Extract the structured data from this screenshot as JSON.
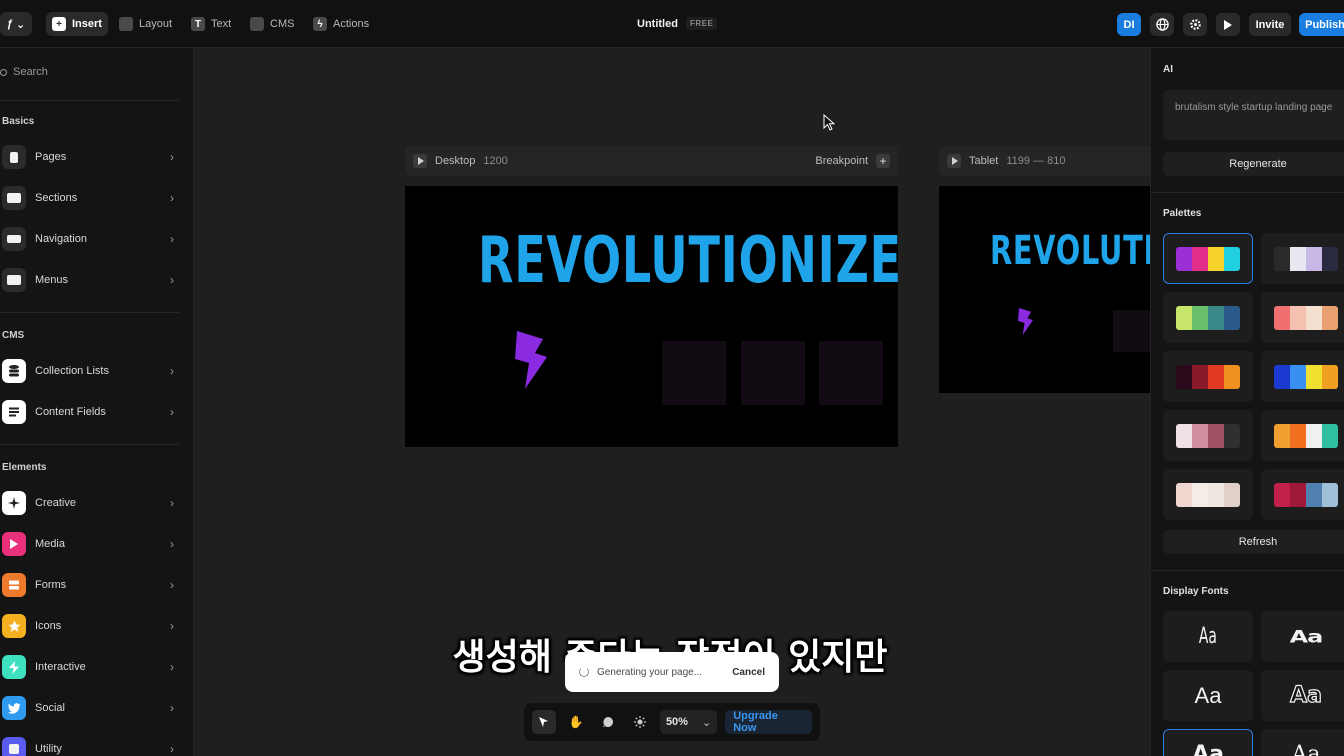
{
  "toolbar": {
    "items": [
      {
        "label": "Insert",
        "icon": "plus-icon"
      },
      {
        "label": "Layout",
        "icon": "layout-icon"
      },
      {
        "label": "Text",
        "icon": "text-icon"
      },
      {
        "label": "CMS",
        "icon": "database-icon"
      },
      {
        "label": "Actions",
        "icon": "bolt-icon"
      }
    ],
    "title": "Untitled",
    "plan_badge": "FREE",
    "avatar_initials": "DI",
    "invite_label": "Invite",
    "publish_label": "Publish"
  },
  "left_panel": {
    "search_placeholder": "Search",
    "sections": {
      "basics": {
        "title": "Basics",
        "items": [
          {
            "label": "Pages",
            "color": "#2b2b2b"
          },
          {
            "label": "Sections",
            "color": "#2b2b2b"
          },
          {
            "label": "Navigation",
            "color": "#2b2b2b"
          },
          {
            "label": "Menus",
            "color": "#2b2b2b"
          }
        ]
      },
      "cms": {
        "title": "CMS",
        "items": [
          {
            "label": "Collection Lists",
            "color": "#ffffff"
          },
          {
            "label": "Content Fields",
            "color": "#ffffff"
          }
        ]
      },
      "elements": {
        "title": "Elements",
        "items": [
          {
            "label": "Creative",
            "color": "#ffffff"
          },
          {
            "label": "Media",
            "color": "#e8317a"
          },
          {
            "label": "Forms",
            "color": "#f07a2c"
          },
          {
            "label": "Icons",
            "color": "#f5b020"
          },
          {
            "label": "Interactive",
            "color": "#3ee0c0"
          },
          {
            "label": "Social",
            "color": "#2f9bf0"
          },
          {
            "label": "Utility",
            "color": "#5b5bf0"
          }
        ]
      }
    }
  },
  "canvas": {
    "desktop": {
      "label": "Desktop",
      "width": "1200",
      "breakpoint_label": "Breakpoint"
    },
    "tablet": {
      "label": "Tablet",
      "range": "1199 — 810"
    },
    "hero_text": "REVOLUTIONIZE",
    "hero_text_tablet": "REVOLUTIO",
    "hero_color": "#1fa4ea",
    "bolt_color": "#8a2be2"
  },
  "right_panel": {
    "ai_title": "AI",
    "prompt": "brutalism style startup landing page",
    "regenerate_label": "Regenerate",
    "palettes_title": "Palettes",
    "palettes": [
      [
        "#9b2fd6",
        "#e2308a",
        "#f6d32a",
        "#20d0e0"
      ],
      [
        "#2a2a2a",
        "#e8e8f0",
        "#c8b8e8",
        "#2a2a40"
      ],
      [
        "#c8e66a",
        "#6ac06a",
        "#3a8a8a",
        "#2a5a8a"
      ],
      [
        "#f07070",
        "#f5c0b0",
        "#f5e0d0",
        "#e8a070"
      ],
      [
        "#2a0a1a",
        "#8a1a2a",
        "#e03a20",
        "#f09020"
      ],
      [
        "#1a3ad0",
        "#3a90f0",
        "#f0e030",
        "#f0a020"
      ],
      [
        "#f0e0e8",
        "#d090a0",
        "#a05060",
        "#303030"
      ],
      [
        "#f0a030",
        "#f07020",
        "#f0f0f0",
        "#30c0a0"
      ],
      [
        "#f0d8d0",
        "#f5ece8",
        "#f0e8e0",
        "#e0d0c8"
      ],
      [
        "#c0204a",
        "#a0183a",
        "#5080b0",
        "#a0c0d8"
      ]
    ],
    "refresh_label": "Refresh",
    "fonts_title": "Display Fonts",
    "fonts": [
      "Aa",
      "Aa",
      "Aa",
      "Aa",
      "Aa",
      "Aa"
    ]
  },
  "bottom_bar": {
    "zoom": "50%",
    "upgrade_label": "Upgrade Now"
  },
  "toast": {
    "message": "Generating your page...",
    "cancel_label": "Cancel"
  },
  "subtitle": "생성해 준다는 장점이 있지만"
}
